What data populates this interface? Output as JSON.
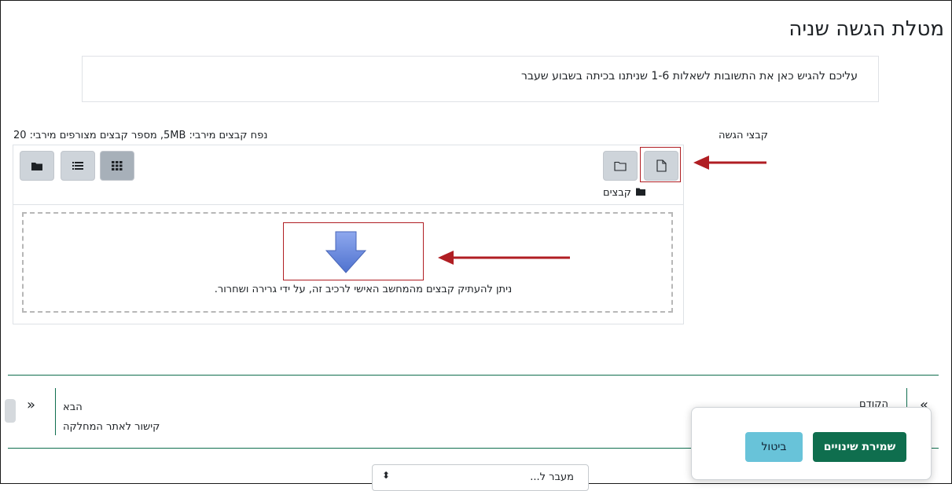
{
  "page": {
    "title": "מטלת הגשה שניה",
    "intro_text": "עליכם להגיש כאן את התשובות לשאלות 1-6 שניתנו בכיתה בשבוע שעבר"
  },
  "submission": {
    "label": "קבצי הגשה",
    "limits_text": "נפח קבצים מירבי: 5MB, מספר קבצים מצורפים מירבי: 20",
    "path_folder": "קבצים",
    "drop_text": "ניתן להעתיק קבצים מהמחשב האישי לרכיב זה, על ידי גרירה ושחרור.",
    "toolbar_left": [
      "view-icons-icon",
      "view-list-icon",
      "view-tree-icon"
    ],
    "toolbar_right": [
      "add-file-icon",
      "create-folder-icon"
    ]
  },
  "navigation": {
    "prev_label": "הקודם",
    "next_label": "הבא",
    "next_link": "קישור לאתר המחלקה",
    "jump_placeholder": "מעבר ל..."
  },
  "actions": {
    "save_label": "שמירת שינויים",
    "cancel_label": "ביטול"
  },
  "colors": {
    "primary": "#0f6e4e",
    "info": "#68c3d9",
    "annotation": "#b01e23",
    "drop_arrow": "#5b7fd6"
  }
}
